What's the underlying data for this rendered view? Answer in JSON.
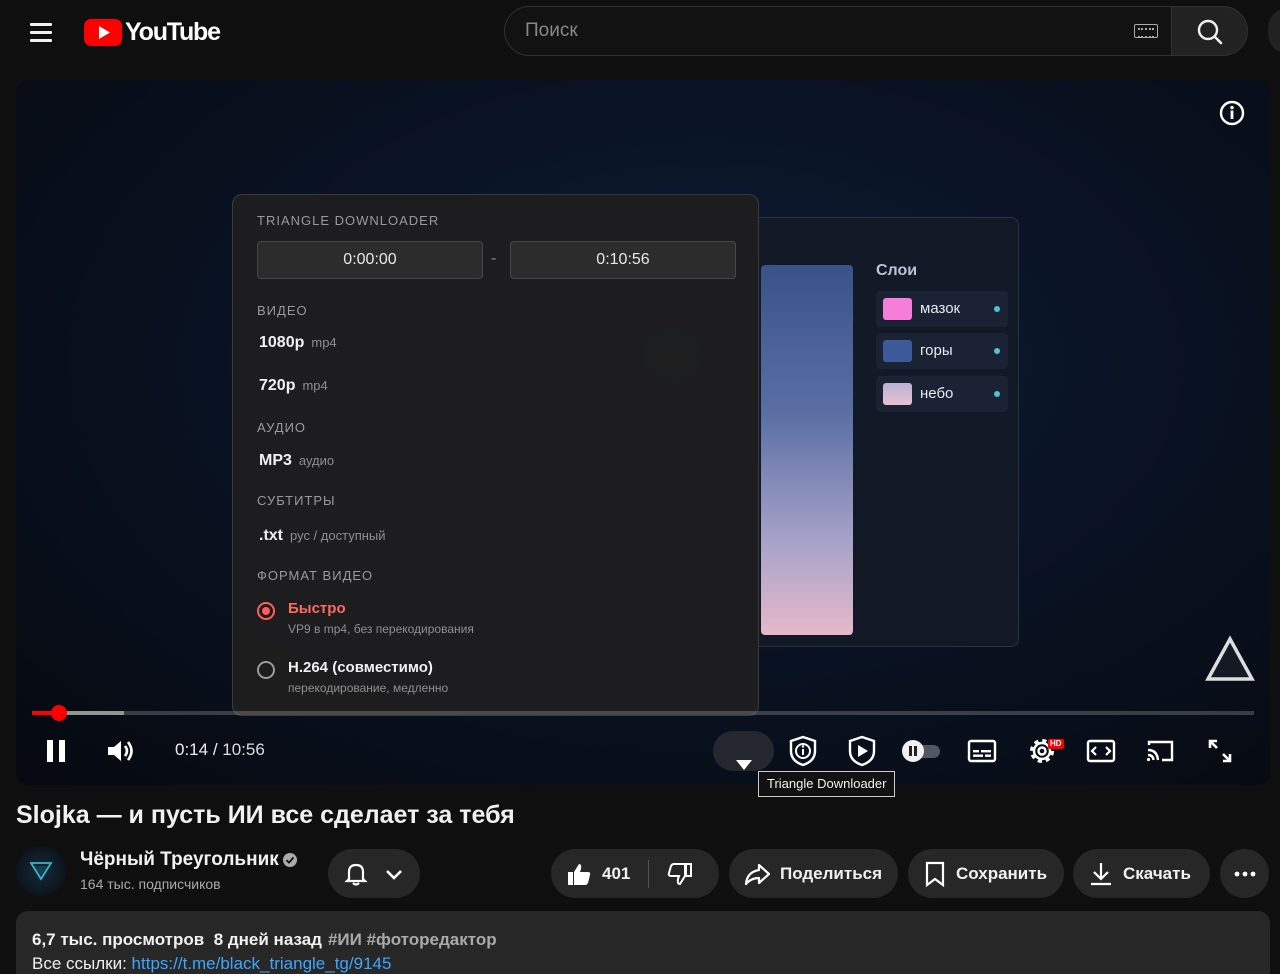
{
  "header": {
    "logo_text": "YouTube",
    "search_placeholder": "Поиск"
  },
  "downloader": {
    "title": "TRIANGLE DOWNLOADER",
    "time_start": "0:00:00",
    "time_sep": "-",
    "time_end": "0:10:56",
    "sections": {
      "video": "ВИДЕО",
      "audio": "АУДИО",
      "subtitles": "СУБТИТРЫ",
      "format": "ФОРМАТ ВИДЕО"
    },
    "video_options": [
      {
        "label": "1080p",
        "sub": "mp4"
      },
      {
        "label": "720p",
        "sub": "mp4"
      }
    ],
    "audio_option": {
      "label": "MP3",
      "sub": "аудио"
    },
    "subtitle_option": {
      "label": ".txt",
      "sub": "рус / доступный"
    },
    "format_options": [
      {
        "label": "Быстро",
        "sub": "VP9 в mp4, без перекодирования",
        "selected": true
      },
      {
        "label": "H.264 (совместимо)",
        "sub": "перекодирование, медленно",
        "selected": false
      }
    ]
  },
  "editor": {
    "layers_title": "Слои",
    "layers": [
      {
        "name": "мазок",
        "color": "#f77ed8"
      },
      {
        "name": "горы",
        "color": "#3c5a9a"
      },
      {
        "name": "небо",
        "color": "#c9b7d6"
      }
    ]
  },
  "player": {
    "current_time": "0:14",
    "duration": "10:56",
    "played_fraction": 0.022,
    "buffered_fraction": 0.075,
    "tooltip": "Triangle Downloader",
    "hd_badge": "HD"
  },
  "video": {
    "title": "Slojka — и пусть ИИ все сделает за тебя",
    "channel_name": "Чёрный Треугольник",
    "subscribers": "164 тыс. подписчиков",
    "likes": "401",
    "share_label": "Поделиться",
    "save_label": "Сохранить",
    "download_label": "Скачать",
    "views": "6,7 тыс. просмотров",
    "date": "8 дней назад",
    "tags": "#ИИ #фоторедактор",
    "links_prefix": "Все ссылки: ",
    "link_url": "https://t.me/black_triangle_tg/9145"
  },
  "colors": {
    "accent_red": "#ff0000",
    "selected_option": "#ff5c5c",
    "link_blue": "#3ea6ff"
  }
}
